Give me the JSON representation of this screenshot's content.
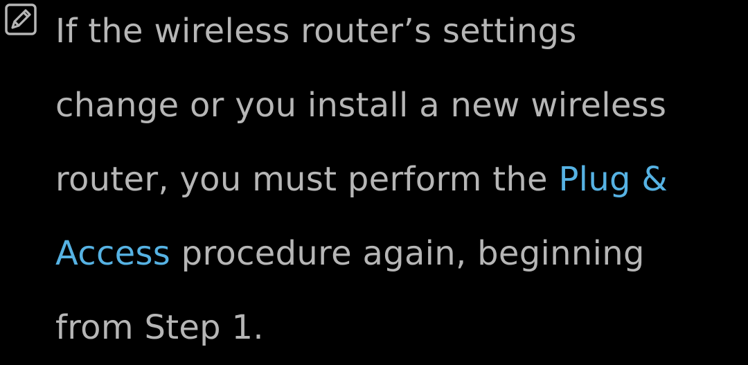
{
  "note": {
    "icon": "note-pencil-icon",
    "lines": [
      [
        "If the wireless router’s settings"
      ],
      [
        "change or you install a new wireless"
      ],
      [
        "router, you must perform the ",
        "Plug &"
      ],
      [
        "Access",
        " procedure again, beginning"
      ],
      [
        "from Step 1."
      ]
    ],
    "link_text": "Plug & Access"
  },
  "colors": {
    "background": "#000000",
    "text": "#b6b6b6",
    "link": "#56b2e3",
    "icon_stroke": "#b6b6b6"
  }
}
